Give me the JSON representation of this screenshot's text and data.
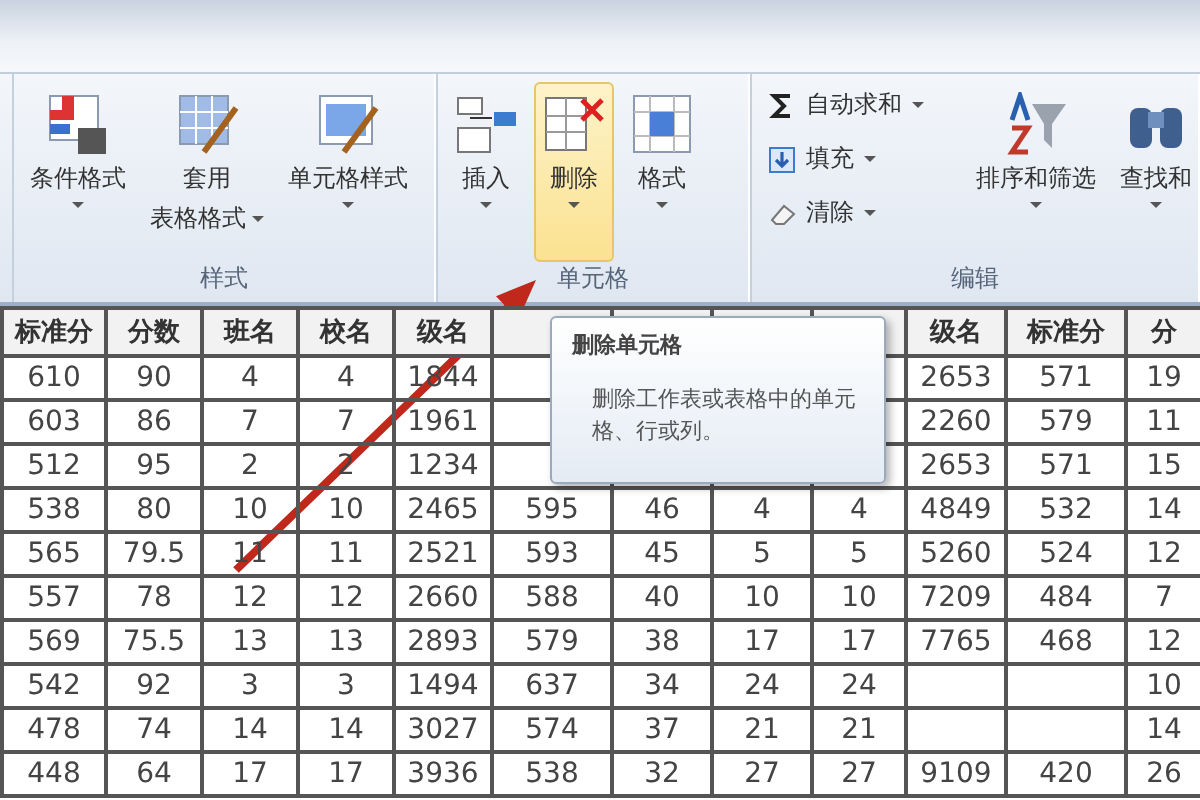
{
  "ribbon": {
    "groups": [
      {
        "label": "样式",
        "items": [
          {
            "kind": "large",
            "lines": [
              "条件格式"
            ],
            "selected": false
          },
          {
            "kind": "large",
            "lines": [
              "套用",
              "表格格式"
            ],
            "selected": false
          },
          {
            "kind": "large",
            "lines": [
              "单元格样式"
            ],
            "selected": false
          }
        ]
      },
      {
        "label": "单元格",
        "items": [
          {
            "kind": "large",
            "lines": [
              "插入"
            ],
            "selected": false
          },
          {
            "kind": "large",
            "lines": [
              "删除"
            ],
            "selected": true
          },
          {
            "kind": "large",
            "lines": [
              "格式"
            ],
            "selected": false
          }
        ]
      },
      {
        "label": "编辑",
        "items": [
          {
            "kind": "small",
            "lines": [
              "自动求和"
            ],
            "selected": false
          },
          {
            "kind": "small",
            "lines": [
              "填充"
            ],
            "selected": false
          },
          {
            "kind": "small",
            "lines": [
              "清除"
            ],
            "selected": false
          },
          {
            "kind": "large",
            "lines": [
              "排序和筛选"
            ],
            "selected": false
          },
          {
            "kind": "large",
            "lines": [
              "查找和"
            ],
            "selected": false
          }
        ]
      }
    ]
  },
  "tooltip": {
    "title": "删除单元格",
    "body": "删除工作表或表格中的单元格、行或列。"
  },
  "table": {
    "columns": [
      "标准分",
      "分数",
      "班名",
      "校名",
      "级名",
      null,
      null,
      null,
      null,
      "级名",
      "标准分",
      "分"
    ],
    "rows": [
      [
        "610",
        "90",
        "4",
        "4",
        "1844",
        null,
        null,
        null,
        null,
        "2653",
        "571",
        "19"
      ],
      [
        "603",
        "86",
        "7",
        "7",
        "1961",
        null,
        null,
        null,
        null,
        "2260",
        "579",
        "11"
      ],
      [
        "512",
        "95",
        "2",
        "2",
        "1234",
        null,
        null,
        null,
        null,
        "2653",
        "571",
        "15"
      ],
      [
        "538",
        "80",
        "10",
        "10",
        "2465",
        "595",
        "46",
        "4",
        "4",
        "4849",
        "532",
        "14"
      ],
      [
        "565",
        "79.5",
        "11",
        "11",
        "2521",
        "593",
        "45",
        "5",
        "5",
        "5260",
        "524",
        "12"
      ],
      [
        "557",
        "78",
        "12",
        "12",
        "2660",
        "588",
        "40",
        "10",
        "10",
        "7209",
        "484",
        "7"
      ],
      [
        "569",
        "75.5",
        "13",
        "13",
        "2893",
        "579",
        "38",
        "17",
        "17",
        "7765",
        "468",
        "12"
      ],
      [
        "542",
        "92",
        "3",
        "3",
        "1494",
        "637",
        "34",
        "24",
        "24",
        null,
        null,
        "10"
      ],
      [
        "478",
        "74",
        "14",
        "14",
        "3027",
        "574",
        "37",
        "21",
        "21",
        null,
        null,
        "14"
      ],
      [
        "448",
        "64",
        "17",
        "17",
        "3936",
        "538",
        "32",
        "27",
        "27",
        "9109",
        "420",
        "26"
      ]
    ]
  }
}
